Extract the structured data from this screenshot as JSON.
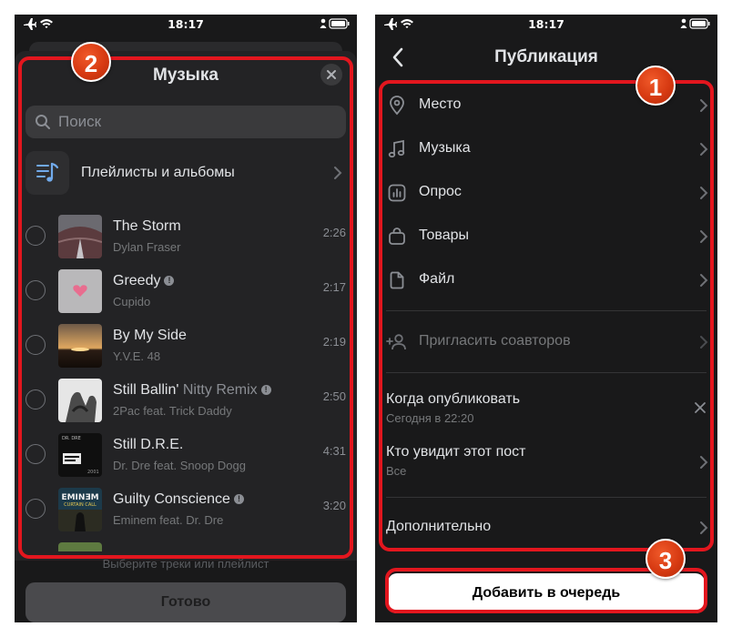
{
  "statusbar": {
    "time": "18:17"
  },
  "music_sheet": {
    "title": "Музыка",
    "search_placeholder": "Поиск",
    "playlists_label": "Плейлисты и альбомы",
    "tracks": [
      {
        "title": "The Storm",
        "subtitle": "",
        "artist": "Dylan Fraser",
        "duration": "2:26",
        "explicit": false
      },
      {
        "title": "Greedy",
        "subtitle": "",
        "artist": "Cupido",
        "duration": "2:17",
        "explicit": true
      },
      {
        "title": "By My Side",
        "subtitle": "",
        "artist": "Y.V.E. 48",
        "duration": "2:19",
        "explicit": false
      },
      {
        "title": "Still Ballin'",
        "subtitle": "Nitty Remix",
        "artist": "2Pac feat. Trick Daddy",
        "duration": "2:50",
        "explicit": true
      },
      {
        "title": "Still D.R.E.",
        "subtitle": "",
        "artist": "Dr. Dre feat. Snoop Dogg",
        "duration": "4:31",
        "explicit": false
      },
      {
        "title": "Guilty Conscience",
        "subtitle": "",
        "artist": "Eminem feat. Dr. Dre",
        "duration": "3:20",
        "explicit": true
      }
    ],
    "cover_texts": {
      "dre": "DR. DRE",
      "dre_year": "2001",
      "eminem": "EMINƎM",
      "eminem_sub": "CURTAIN CALL"
    },
    "hint": "Выберите треки или плейлист",
    "done_label": "Готово"
  },
  "publication": {
    "title": "Публикация",
    "items": [
      {
        "label": "Место",
        "icon": "map-pin-icon"
      },
      {
        "label": "Музыка",
        "icon": "music-note-icon"
      },
      {
        "label": "Опрос",
        "icon": "poll-icon"
      },
      {
        "label": "Товары",
        "icon": "shopping-bag-icon"
      },
      {
        "label": "Файл",
        "icon": "file-icon"
      }
    ],
    "invite_label": "Пригласить соавторов",
    "when_label": "Когда опубликовать",
    "when_value": "Сегодня в 22:20",
    "who_label": "Кто увидит этот пост",
    "who_value": "Все",
    "additional_label": "Дополнительно",
    "queue_button": "Добавить в очередь"
  },
  "annotations": {
    "badge_1": "1",
    "badge_2": "2",
    "badge_3": "3"
  },
  "colors": {
    "background": "#19191a",
    "sheet": "#232325",
    "accent_red": "#e3161e",
    "badge_orange": "#d73a12",
    "icon_blue": "#71aaeb"
  }
}
